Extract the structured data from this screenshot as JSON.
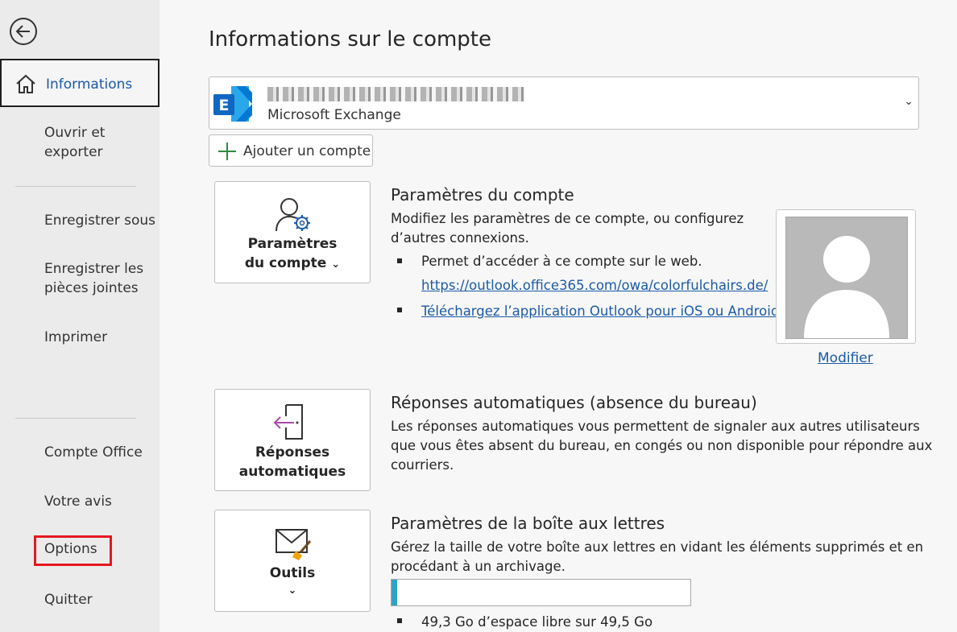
{
  "sidebar": {
    "active": "Informations",
    "items": [
      "Ouvrir et exporter",
      "Enregistrer sous",
      "Enregistrer les pièces jointes",
      "Imprimer",
      "Compte Office",
      "Votre avis",
      "Options",
      "Quitter"
    ]
  },
  "page_title": "Informations sur le compte",
  "account": {
    "type": "Microsoft Exchange"
  },
  "add_account_label": "Ajouter un compte",
  "account_settings": {
    "tile_line1": "Paramètres",
    "tile_line2": "du compte",
    "title": "Paramètres du compte",
    "desc_line1": "Modifiez les paramètres de ce compte, ou configurez",
    "desc_line2": "d’autres connexions.",
    "bullet1": "Permet d’accéder à ce compte sur le web.",
    "link1": "https://outlook.office365.com/owa/colorfulchairs.de/",
    "link2": "Téléchargez l’application Outlook pour iOS ou Android.",
    "modify_label": "Modifier"
  },
  "auto_replies": {
    "tile_line1": "Réponses",
    "tile_line2": "automatiques",
    "title": "Réponses automatiques (absence du bureau)",
    "desc_line1": "Les réponses automatiques vous permettent de signaler aux autres utilisateurs",
    "desc_line2": "que vous êtes absent du bureau, en congés ou non disponible pour répondre aux",
    "desc_line3": "courriers."
  },
  "mailbox": {
    "tile_label": "Outils",
    "title": "Paramètres de la boîte aux lettres",
    "desc_line1": "Gérez la taille de votre boîte aux lettres en vidant les éléments supprimés et en",
    "desc_line2": "procédant à un archivage.",
    "free_space": "49,3 Go d’espace libre sur 49,5 Go",
    "used_fraction": 0.02
  },
  "colors": {
    "accent": "#1b5aa7",
    "highlight": "#e5181f",
    "storage": "#2ea3c8"
  }
}
